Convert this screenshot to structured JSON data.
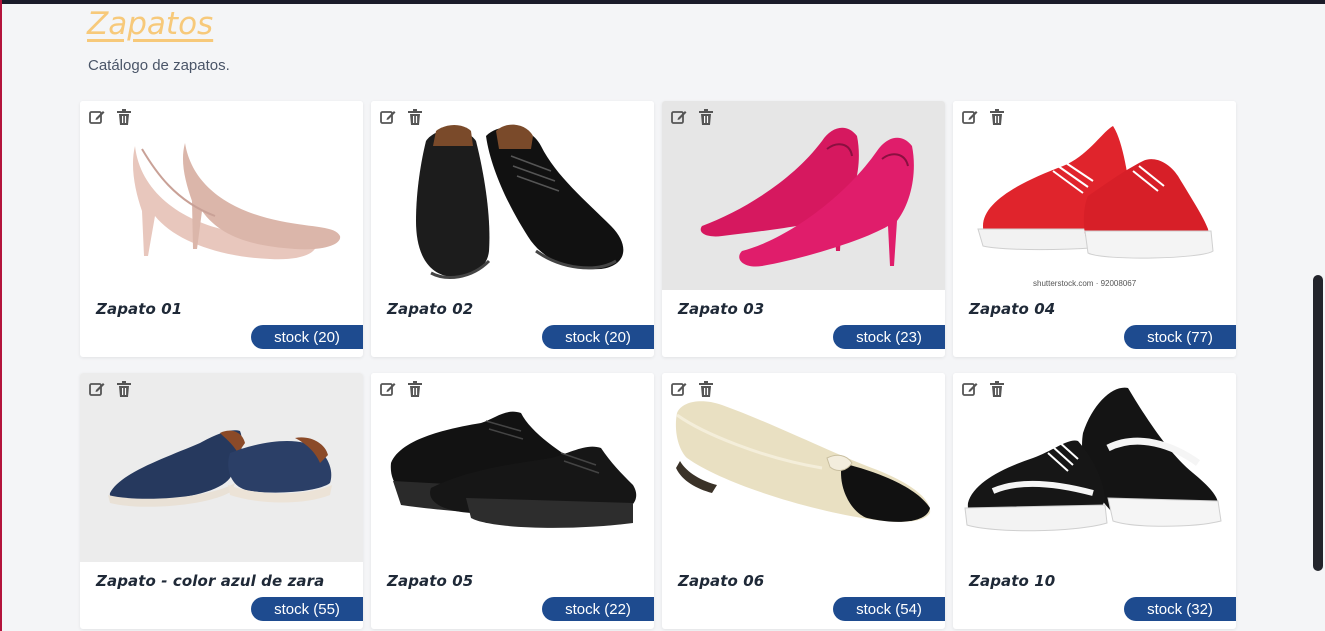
{
  "header": {
    "title": "Zapatos",
    "subtitle": "Catálogo de zapatos."
  },
  "colors": {
    "title": "#f7c97a",
    "badge": "#1e4b8f",
    "topbar": "#1b1c2a"
  },
  "products": [
    {
      "name": "Zapato 01",
      "stock": "stock (20)",
      "image": "nude-heel-icon"
    },
    {
      "name": "Zapato 02",
      "stock": "stock (20)",
      "image": "black-oxford-icon"
    },
    {
      "name": "Zapato 03",
      "stock": "stock (23)",
      "image": "pink-heel-icon"
    },
    {
      "name": "Zapato 04",
      "stock": "stock (77)",
      "image": "red-sneaker-icon",
      "watermark": "shutterstock.com · 92008067"
    },
    {
      "name": "Zapato - color azul de zara",
      "stock": "stock (55)",
      "image": "blue-shoe-icon"
    },
    {
      "name": "Zapato 05",
      "stock": "stock (22)",
      "image": "black-oxford-icon"
    },
    {
      "name": "Zapato 06",
      "stock": "stock (54)",
      "image": "ballet-flat-icon"
    },
    {
      "name": "Zapato 10",
      "stock": "stock (32)",
      "image": "black-sneaker-icon"
    }
  ]
}
